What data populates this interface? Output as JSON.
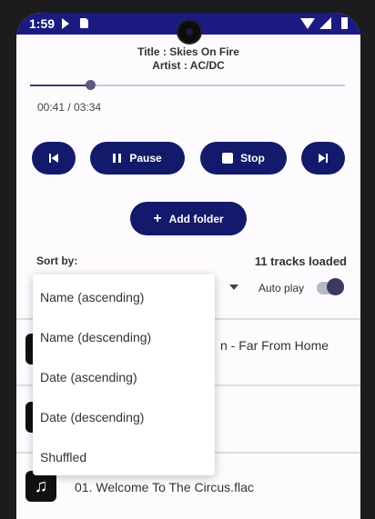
{
  "status_bar": {
    "time": "1:59"
  },
  "now_playing": {
    "title_line": "Title : Skies On Fire",
    "artist_line": "Artist : AC/DC",
    "time_text": "00:41 / 03:34",
    "progress_fraction": 0.19
  },
  "controls": {
    "pause_label": "Pause",
    "stop_label": "Stop"
  },
  "add_folder_label": "Add folder",
  "sort": {
    "label": "Sort by:"
  },
  "tracks_loaded": "11 tracks loaded",
  "autoplay": {
    "label": "Auto play",
    "on": true
  },
  "sort_menu": {
    "items": [
      "Name (ascending)",
      "Name (descending)",
      "Date (ascending)",
      "Date (descending)",
      "Shuffled"
    ]
  },
  "tracks": {
    "visible_fragment": "n - Far From Home",
    "third_track": "01. Welcome To The Circus.flac"
  },
  "colors": {
    "accent": "#131a6b",
    "status_bar": "#1a1a80"
  }
}
